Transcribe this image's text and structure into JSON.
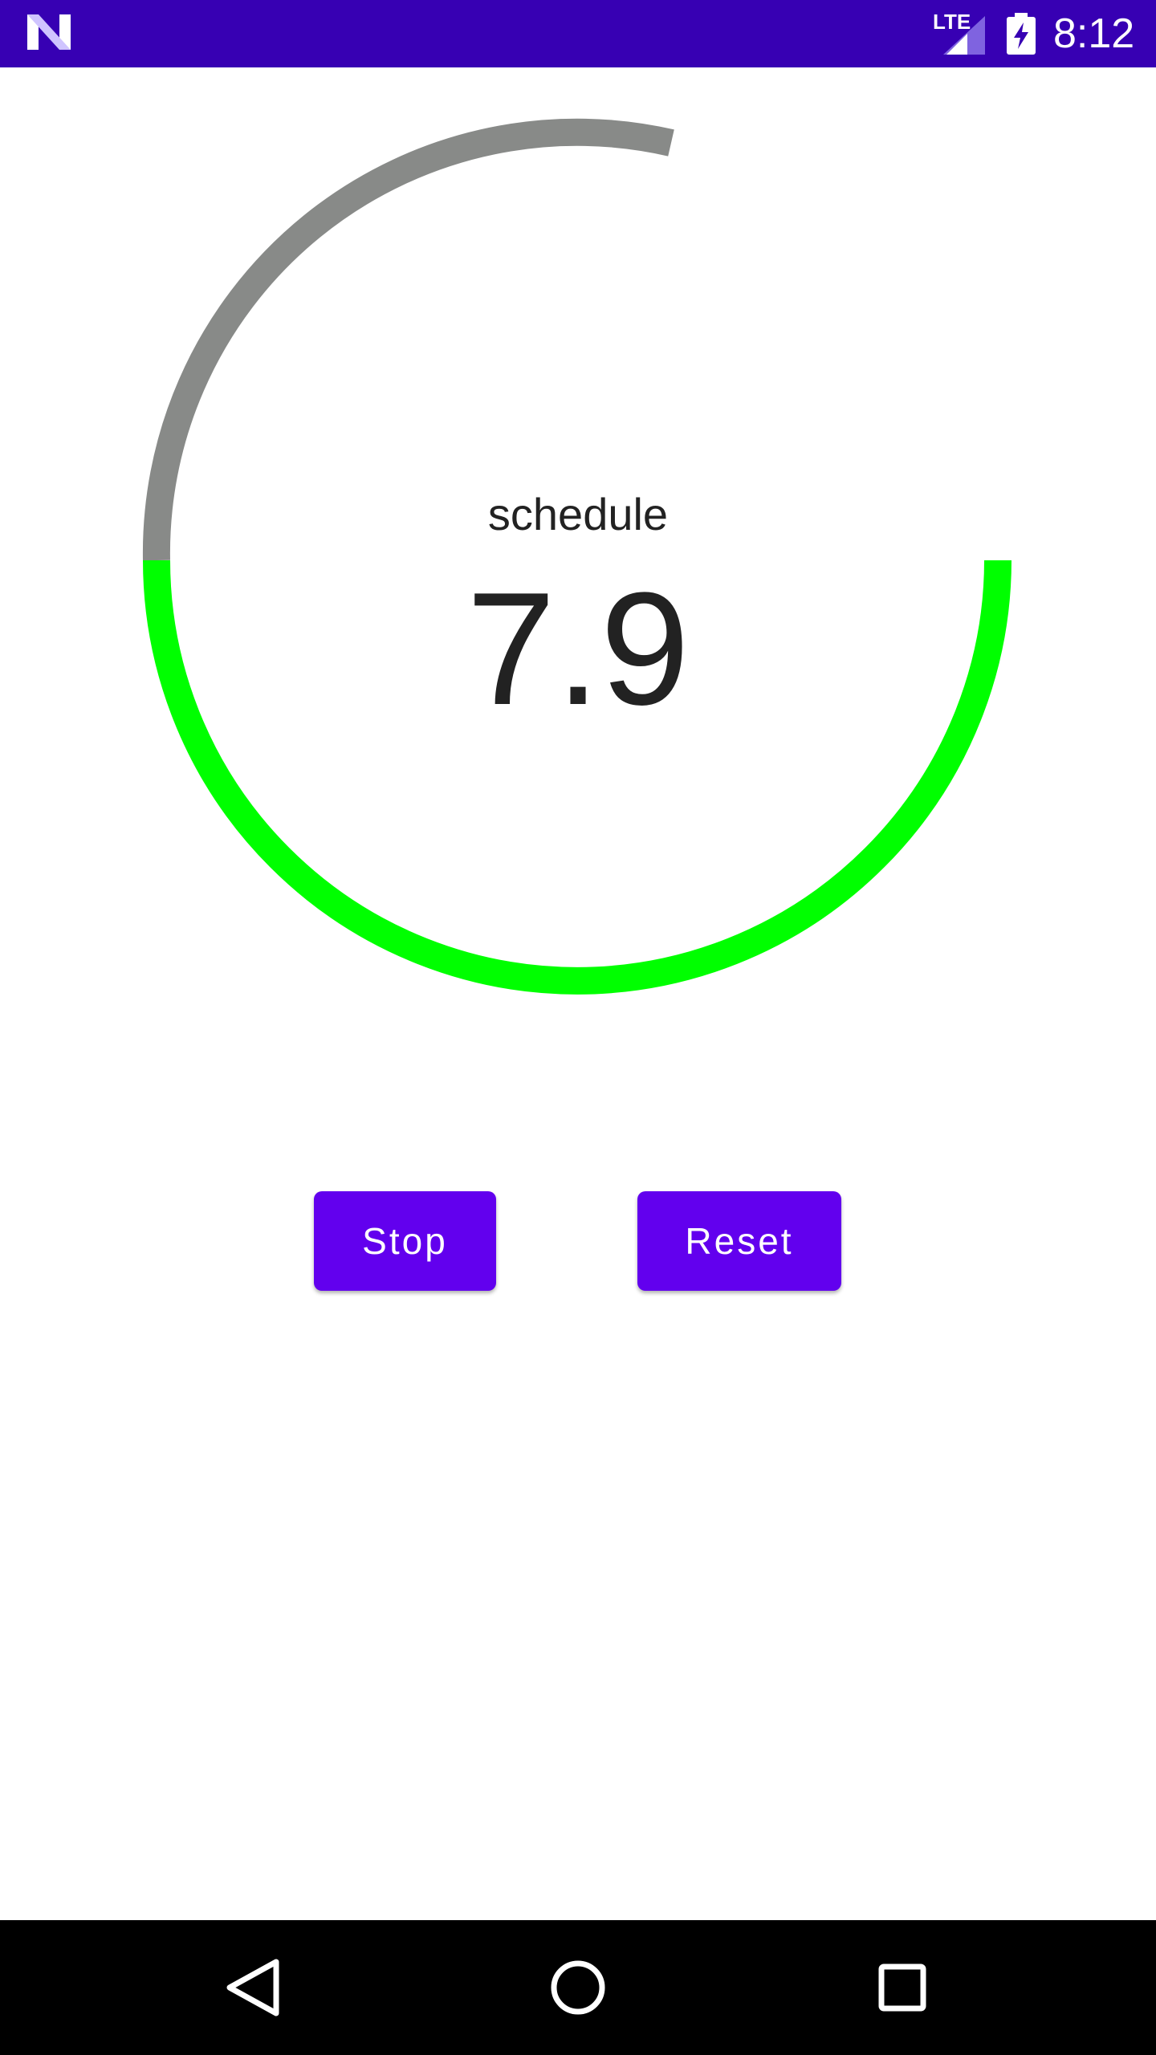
{
  "status_bar": {
    "network": "LTE",
    "time": "8:12",
    "logo_icon": "n-logo-icon",
    "signal_icon": "signal-icon",
    "battery_icon": "battery-charging-icon"
  },
  "gauge": {
    "label": "schedule",
    "value": "7.9",
    "progress_color": "#00ff00",
    "track_color": "#888a88"
  },
  "buttons": {
    "stop_label": "Stop",
    "reset_label": "Reset",
    "color": "#6200ee"
  },
  "nav_bar": {
    "back_icon": "back-icon",
    "home_icon": "home-icon",
    "recents_icon": "recents-icon"
  },
  "colors": {
    "status_bar": "#3700b3",
    "nav_bar": "#000000",
    "background": "#ffffff"
  }
}
